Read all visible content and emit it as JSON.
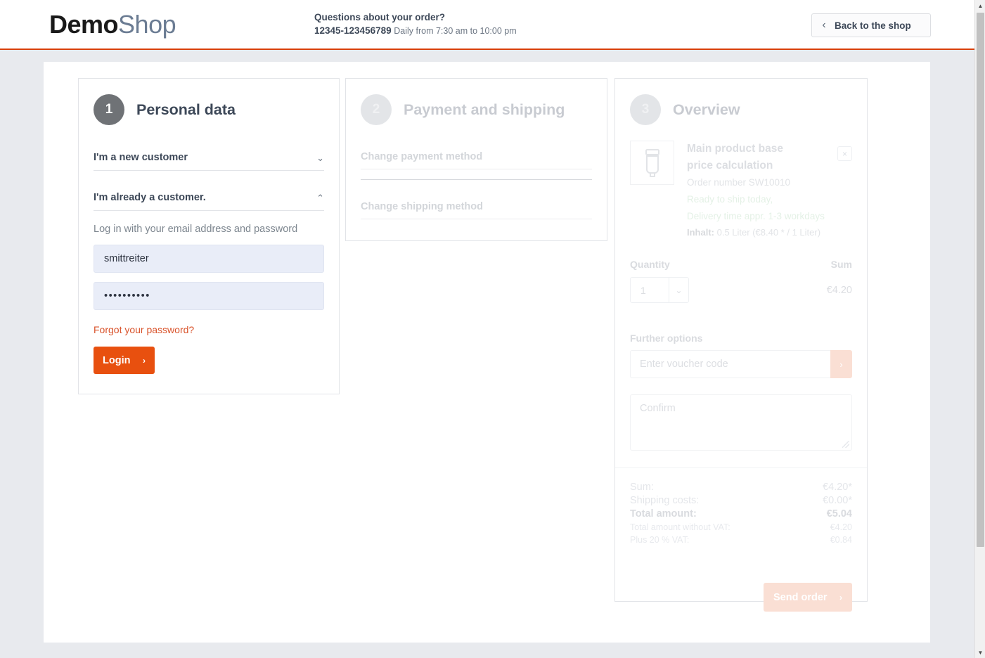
{
  "header": {
    "logo_bold": "Demo",
    "logo_light": "Shop",
    "contact_question": "Questions about your order?",
    "contact_phone": "12345-123456789",
    "contact_hours": "Daily from 7:30 am to 10:00 pm",
    "back_label": "Back to the shop",
    "back_chevron": "‹",
    "accent_color": "#d9400b"
  },
  "panel1": {
    "step": "1",
    "title": "Personal data",
    "accordion_new": "I'm a new customer",
    "accordion_new_chevron": "⌄",
    "accordion_existing": "I'm already a customer.",
    "accordion_existing_chevron": "⌃",
    "login_hint": "Log in with your email address and password",
    "email_value": "smittreiter",
    "password_value": "••••••••••",
    "forgot_label": "Forgot your password?",
    "login_label": "Login",
    "login_arrow": "›",
    "login_color": "#e8500f",
    "forgot_color": "#d9532b"
  },
  "panel2": {
    "step": "2",
    "title": "Payment and shipping",
    "change_payment": "Change payment method",
    "change_shipping": "Change shipping method"
  },
  "panel3": {
    "step": "3",
    "title": "Overview",
    "product": {
      "image_icon": "tube-product-icon",
      "name": "Main product base price calculation",
      "order_number": "Order number SW10010",
      "ready_line": "Ready to ship today,",
      "delivery_line": "Delivery time appr. 1-3 workdays",
      "content_label": "Inhalt:",
      "content_value": "0.5 Liter (€8.40 * / 1 Liter)",
      "remove_label": "×"
    },
    "quantity_header": "Quantity",
    "sum_header": "Sum",
    "quantity_value": "1",
    "quantity_chevron": "⌄",
    "line_sum": "€4.20",
    "further_options": "Further options",
    "voucher_placeholder": "Enter voucher code",
    "voucher_value": "",
    "voucher_arrow": "›",
    "confirm_placeholder": "Confirm",
    "totals": [
      {
        "label": "Sum:",
        "value": "€4.20*",
        "style": "lg"
      },
      {
        "label": "Shipping costs:",
        "value": "€0.00*",
        "style": "lg"
      },
      {
        "label": "Total amount:",
        "value": "€5.04",
        "style": "bold"
      },
      {
        "label": "Total amount without VAT:",
        "value": "€4.20",
        "style": "sm"
      },
      {
        "label": "Plus 20 % VAT:",
        "value": "€0.84",
        "style": "sm"
      }
    ],
    "send_label": "Send order",
    "send_arrow": "›",
    "send_color": "#fadfd4"
  },
  "scrollbar": {
    "up_arrow": "▲",
    "down_arrow": "▼"
  }
}
